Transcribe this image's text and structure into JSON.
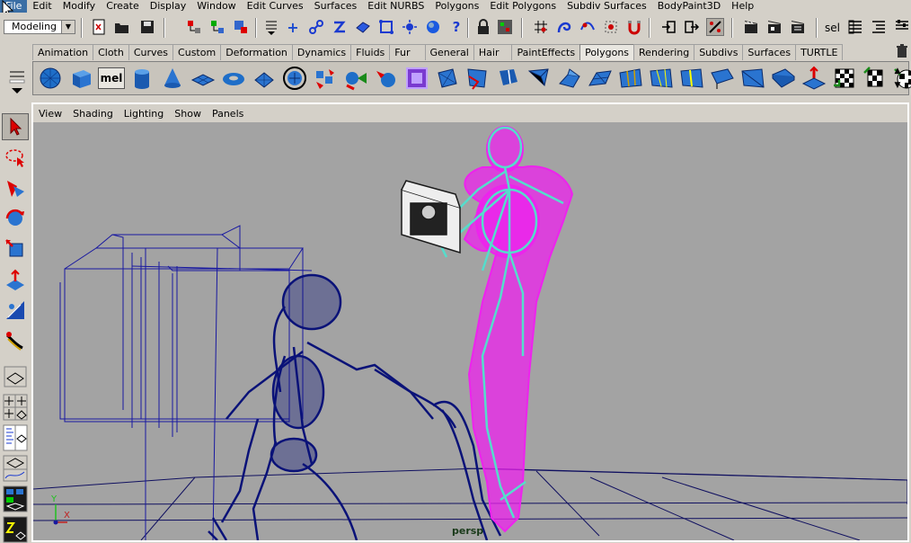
{
  "menubar": {
    "items": [
      "File",
      "Edit",
      "Modify",
      "Create",
      "Display",
      "Window",
      "Edit Curves",
      "Surfaces",
      "Edit NURBS",
      "Polygons",
      "Edit Polygons",
      "Subdiv Surfaces",
      "BodyPaint3D",
      "Help"
    ],
    "active_index": 0
  },
  "statusline": {
    "mode": "Modeling",
    "selection_field": "sel"
  },
  "shelf_tabs": {
    "items": [
      "Animation",
      "Cloth",
      "Curves",
      "Custom",
      "Deformation",
      "Dynamics",
      "Fluids",
      "Fur",
      "General",
      "Hair",
      "PaintEffects",
      "Polygons",
      "Rendering",
      "Subdivs",
      "Surfaces",
      "TURTLE"
    ],
    "active": "Polygons"
  },
  "shelf": {
    "mel_label": "mel"
  },
  "panel_menu": {
    "items": [
      "View",
      "Shading",
      "Lighting",
      "Show",
      "Panels"
    ]
  },
  "viewport": {
    "camera_label": "persp",
    "axis_x": "X",
    "axis_y": "Y",
    "colors": {
      "background": "#a3a3a3",
      "grid": "#101060",
      "figure": "#ee22ee",
      "skeleton_joints": "#55ddcc",
      "skeleton_mesh": "#0a1278"
    }
  }
}
